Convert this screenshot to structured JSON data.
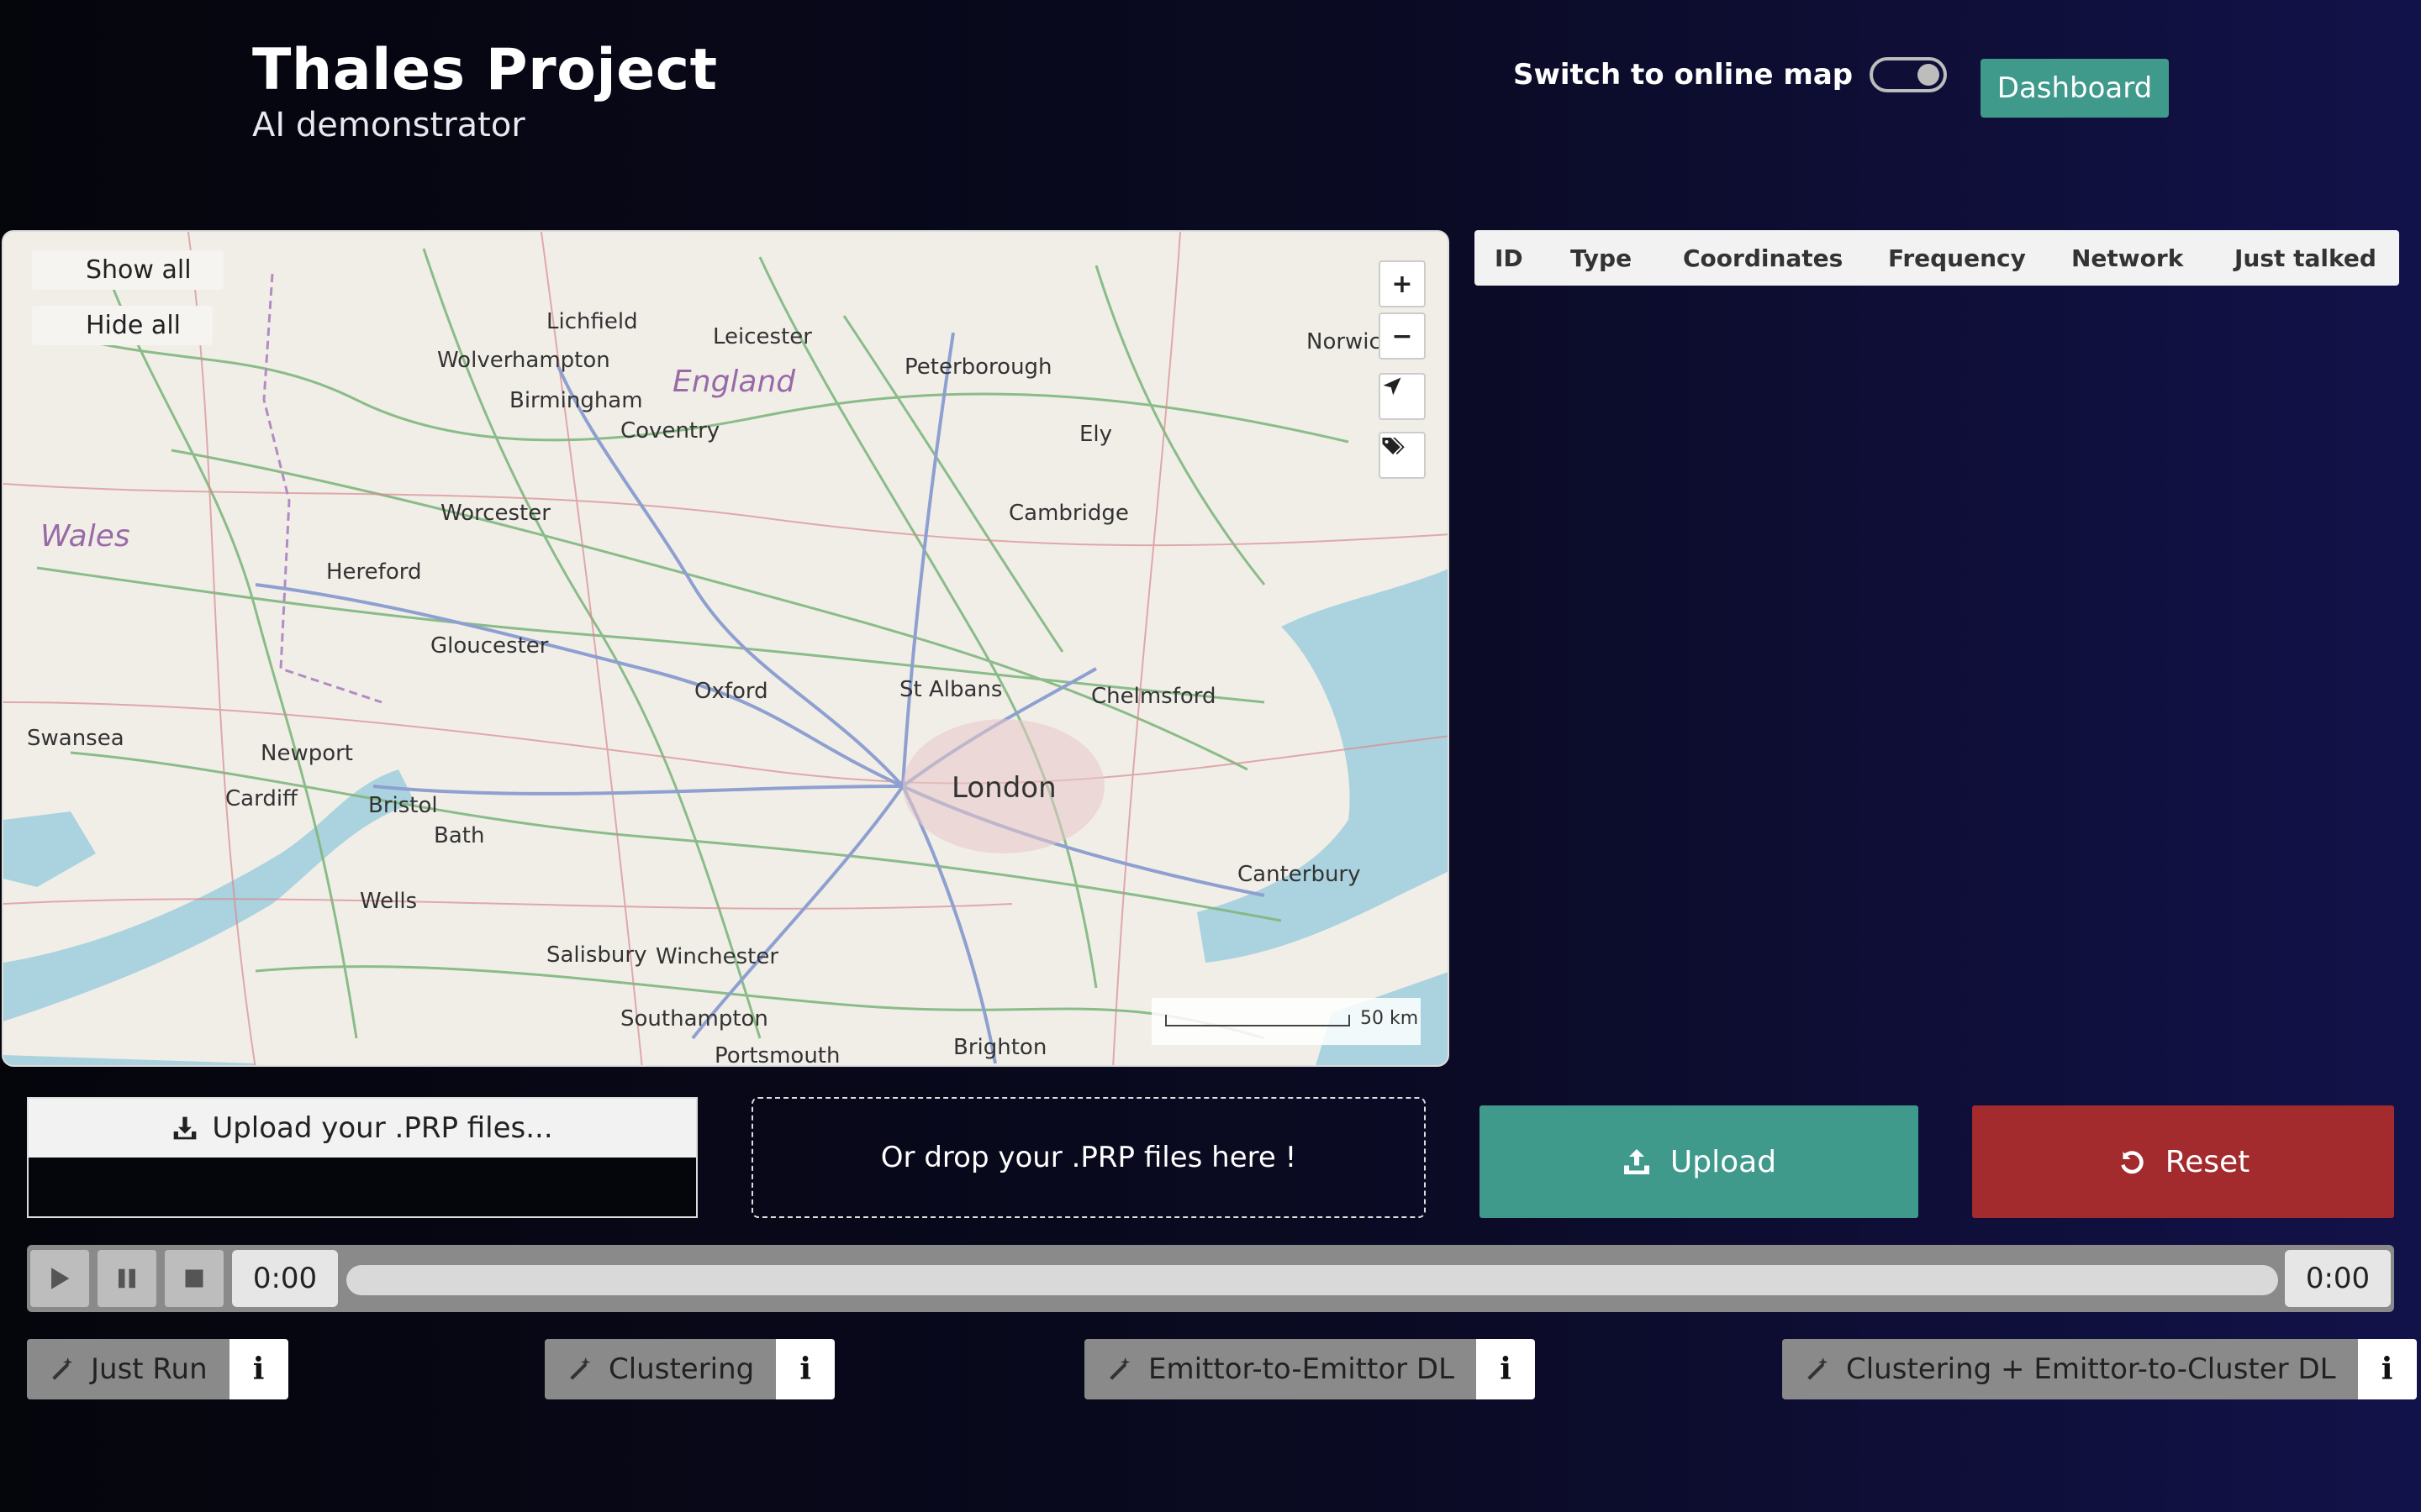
{
  "header": {
    "title": "Thales Project",
    "subtitle": "AI demonstrator"
  },
  "switch": {
    "label": "Switch to online map",
    "state": "on"
  },
  "dashboard": {
    "label": "Dashboard"
  },
  "map": {
    "buttons": {
      "show_all": "Show all",
      "hide_all": "Hide all"
    },
    "controls": {
      "zoom_in": "+",
      "zoom_out": "−"
    },
    "scale": "50 km",
    "labels": [
      {
        "text": "Lichfield"
      },
      {
        "text": "Leicester"
      },
      {
        "text": "Wolverhampton"
      },
      {
        "text": "England",
        "kind": "region"
      },
      {
        "text": "Birmingham"
      },
      {
        "text": "Peterborough"
      },
      {
        "text": "Norwich"
      },
      {
        "text": "Coventry"
      },
      {
        "text": "Ely"
      },
      {
        "text": "Worcester"
      },
      {
        "text": "Cambridge"
      },
      {
        "text": "Wales",
        "kind": "region"
      },
      {
        "text": "Hereford"
      },
      {
        "text": "Gloucester"
      },
      {
        "text": "Oxford"
      },
      {
        "text": "St Albans"
      },
      {
        "text": "Chelmsford"
      },
      {
        "text": "Swansea"
      },
      {
        "text": "Newport"
      },
      {
        "text": "Cardiff"
      },
      {
        "text": "Bristol"
      },
      {
        "text": "London",
        "kind": "big"
      },
      {
        "text": "Bath"
      },
      {
        "text": "Canterbury"
      },
      {
        "text": "Wells"
      },
      {
        "text": "Salisbury"
      },
      {
        "text": "Winchester"
      },
      {
        "text": "Southampton"
      },
      {
        "text": "Brighton"
      },
      {
        "text": "Portsmouth"
      }
    ]
  },
  "table": {
    "columns": [
      "ID",
      "Type",
      "Coordinates",
      "Frequency",
      "Network",
      "Just talked"
    ],
    "rows": []
  },
  "upload": {
    "button_label": "Upload your .PRP files...",
    "drop_label": "Or drop your .PRP files here !"
  },
  "actions": {
    "upload": "Upload",
    "reset": "Reset"
  },
  "player": {
    "current_time": "0:00",
    "total_time": "0:00",
    "progress": 0
  },
  "modes": [
    {
      "label": "Just Run"
    },
    {
      "label": "Clustering"
    },
    {
      "label": "Emittor-to-Emittor DL"
    },
    {
      "label": "Clustering + Emittor-to-Cluster DL"
    }
  ],
  "colors": {
    "teal": "#3f9a8c",
    "red": "#a32a2d"
  }
}
